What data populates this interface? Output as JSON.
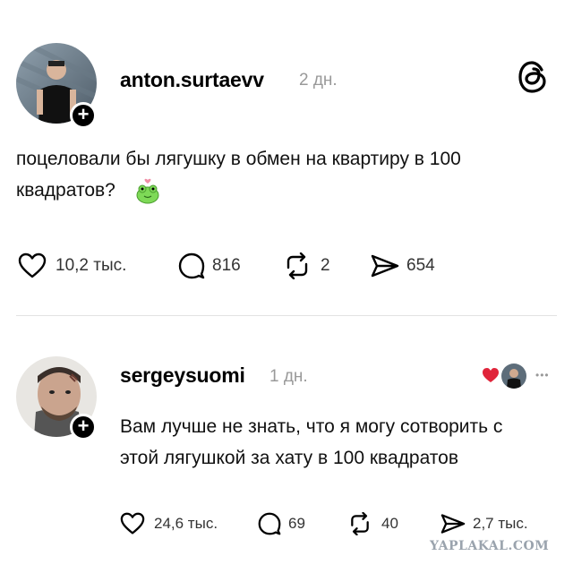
{
  "posts": [
    {
      "username": "anton.surtaevv",
      "time": "2 дн.",
      "text_line1": "поцеловали бы лягушку в обмен на квартиру в 100",
      "text_line2": "квадратов?",
      "likes": "10,2 тыс.",
      "replies": "816",
      "reposts": "2",
      "shares": "654"
    },
    {
      "username": "sergeysuomi",
      "time": "1 дн.",
      "text_line1": "Вам лучше не знать, что я могу сотворить с",
      "text_line2": "этой лягушкой за хату в 100 квадратов",
      "likes": "24,6 тыс.",
      "replies": "69",
      "reposts": "40",
      "shares": "2,7 тыс."
    }
  ],
  "more_label": "•••",
  "watermark": "YAPLAKAL.COM",
  "icons": [
    "threads-logo-icon",
    "plus-icon",
    "heart-icon",
    "comment-icon",
    "repost-icon",
    "share-icon",
    "frog-emoji-icon",
    "liked-heart-icon",
    "more-icon"
  ],
  "colors": {
    "time": "#999999",
    "liked_heart": "#e0243a",
    "frog": "#7ed957"
  }
}
